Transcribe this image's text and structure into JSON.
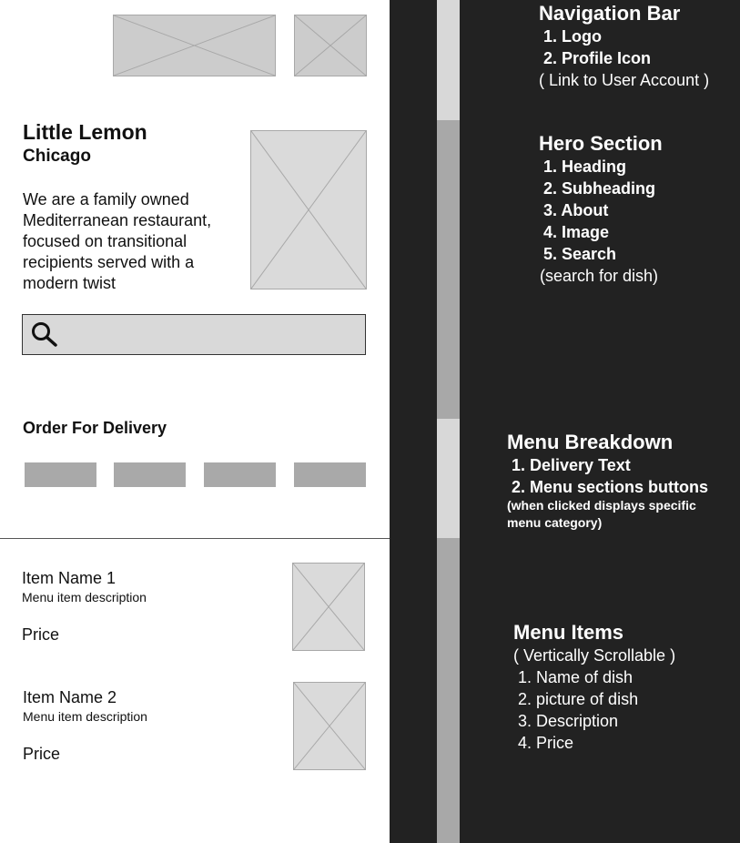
{
  "hero": {
    "title": "Little Lemon",
    "subtitle": "Chicago",
    "about": "We are a family owned Mediterranean restaurant, focused on transitional recipients served with a modern twist"
  },
  "delivery": {
    "heading": "Order For Delivery"
  },
  "menu_items": [
    {
      "name": "Item Name 1",
      "description": "Menu item description",
      "price": "Price"
    },
    {
      "name": "Item Name 2",
      "description": "Menu item description",
      "price": "Price"
    }
  ],
  "annotations": {
    "nav": {
      "title": "Navigation Bar",
      "lines": [
        "1. Logo",
        "2. Profile Icon",
        "( Link to User Account )"
      ]
    },
    "hero": {
      "title": "Hero Section",
      "lines": [
        "1. Heading",
        "2. Subheading",
        "3. About",
        "4. Image",
        "5. Search",
        "(search for dish)"
      ]
    },
    "breakdown": {
      "title": "Menu Breakdown",
      "lines": [
        "1. Delivery Text",
        "2. Menu sections buttons",
        "(when clicked displays specific",
        "menu category)"
      ]
    },
    "items": {
      "title": "Menu Items",
      "lines": [
        "( Vertically Scrollable )",
        "1. Name of dish",
        "2. picture of dish",
        "3. Description",
        "4. Price"
      ]
    }
  },
  "colors": {
    "background_dark": "#222222",
    "placeholder": "#cccccc",
    "button": "#a9a9a9",
    "bar_light": "#d8d8d8",
    "bar_dark": "#a8a8a8"
  }
}
